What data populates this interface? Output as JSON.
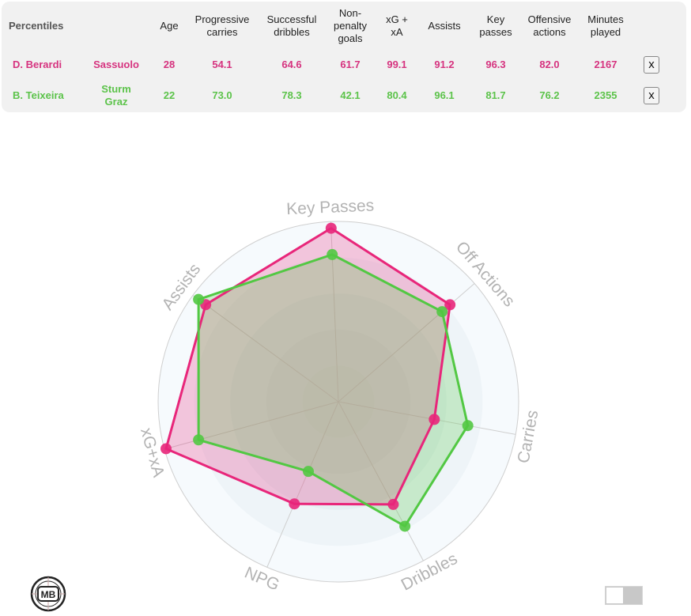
{
  "table": {
    "title": "Percentiles",
    "columns": [
      "Age",
      "Progressive carries",
      "Successful dribbles",
      "Non-penalty goals",
      "xG + xA",
      "Assists",
      "Key passes",
      "Offensive actions",
      "Minutes played"
    ],
    "column_lines": [
      [
        "Age"
      ],
      [
        "Progressive",
        "carries"
      ],
      [
        "Successful",
        "dribbles"
      ],
      [
        "Non-",
        "penalty",
        "goals"
      ],
      [
        "xG +",
        "xA"
      ],
      [
        "Assists"
      ],
      [
        "Key",
        "passes"
      ],
      [
        "Offensive",
        "actions"
      ],
      [
        "Minutes",
        "played"
      ]
    ],
    "rows": [
      {
        "player": "D. Berardi",
        "team": "Sassuolo",
        "team_lines": [
          "Sassuolo"
        ],
        "color": "#d6337f",
        "values": [
          "28",
          "54.1",
          "64.6",
          "61.7",
          "99.1",
          "91.2",
          "96.3",
          "82.0",
          "2167"
        ],
        "remove_label": "x"
      },
      {
        "player": "B. Teixeira",
        "team": "Sturm Graz",
        "team_lines": [
          "Sturm",
          "Graz"
        ],
        "color": "#5cc34a",
        "values": [
          "22",
          "73.0",
          "78.3",
          "42.1",
          "80.4",
          "96.1",
          "81.7",
          "76.2",
          "2355"
        ],
        "remove_label": "x"
      }
    ]
  },
  "chart_data": {
    "type": "radar",
    "title": "",
    "axes": [
      "Key Passes",
      "Off Actions",
      "Carries",
      "Dribbles",
      "NPG",
      "xG+xA",
      "Assists"
    ],
    "range": [
      0,
      100
    ],
    "grid": true,
    "series": [
      {
        "name": "D. Berardi",
        "color": "#e8267a",
        "fill": "rgba(232,38,122,0.25)",
        "values": [
          96.3,
          82.0,
          54.1,
          64.6,
          61.7,
          99.1,
          91.2
        ]
      },
      {
        "name": "B. Teixeira",
        "color": "#52c843",
        "fill": "rgba(82,200,67,0.25)",
        "values": [
          81.7,
          76.2,
          73.0,
          78.3,
          42.1,
          80.4,
          96.1
        ]
      }
    ]
  },
  "footer": {
    "logo_text": "MB",
    "logo_icon": "mb-logo-icon",
    "toggle_state": "off"
  }
}
